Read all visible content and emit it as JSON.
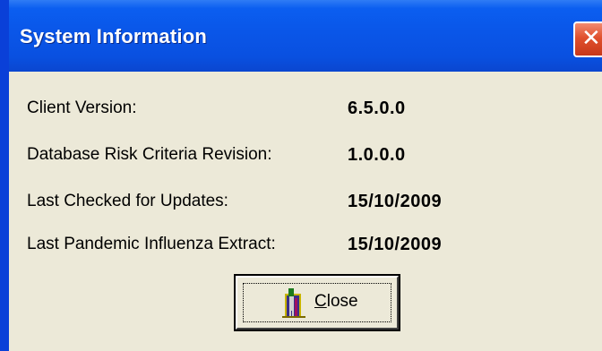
{
  "window": {
    "title": "System Information",
    "close_glyph": "✕"
  },
  "info": {
    "rows": [
      {
        "label": "Client Version:",
        "value": "6.5.0.0"
      },
      {
        "label": "Database Risk Criteria Revision:",
        "value": "1.0.0.0"
      },
      {
        "label": "Last Checked for Updates:",
        "value": "15/10/2009"
      },
      {
        "label": "Last Pandemic Influenza Extract:",
        "value": "15/10/2009"
      }
    ]
  },
  "button": {
    "label_underlined": "C",
    "label_rest": "lose",
    "icon": "door-exit-icon"
  },
  "colors": {
    "titlebar": "#0a56e8",
    "close": "#e0502d",
    "face": "#ece9d8"
  }
}
